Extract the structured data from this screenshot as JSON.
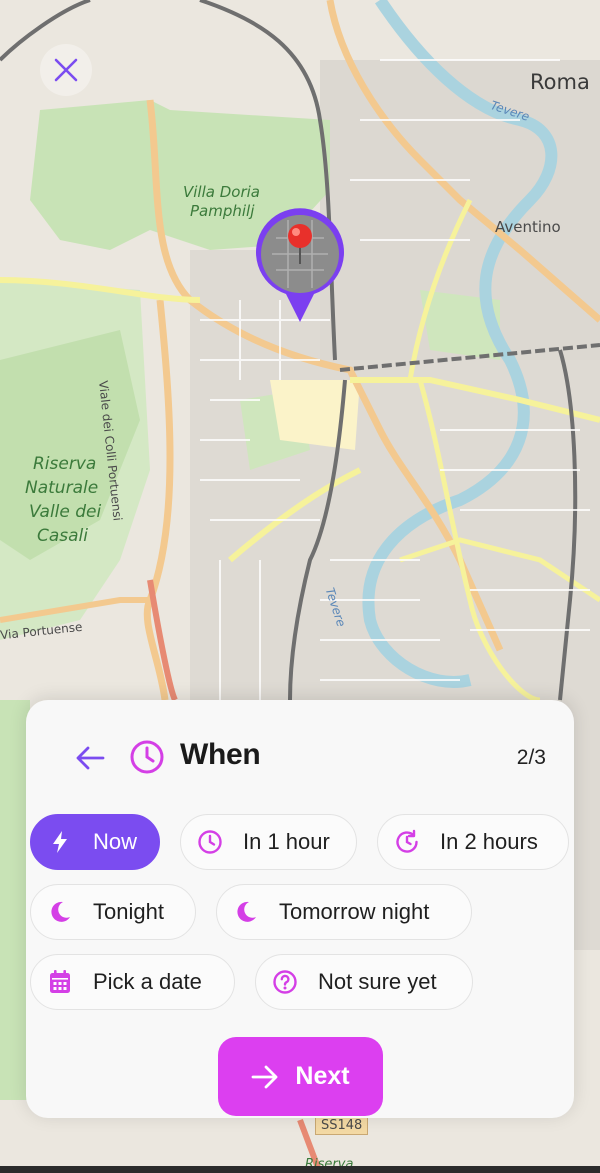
{
  "map": {
    "labels": {
      "roma": "Roma",
      "villa_doria": "Villa Doria",
      "pamphilj": "Pamphilj",
      "tevere_top": "Tevere",
      "aventino": "Aventino",
      "viale_colli": "Viale dei Colli Portuensi",
      "riserva1": "Riserva",
      "riserva2": "Naturale",
      "riserva3": "Valle dei",
      "riserva4": "Casali",
      "via_portuense": "Via Portuense",
      "tevere_mid": "Tevere",
      "ss148": "SS148",
      "riserva_bottom": "Riserva"
    },
    "colors": {
      "park": "#c8e3b6",
      "road_major": "#f3c98f",
      "road_yellow": "#f6f29b",
      "water": "#aad3df",
      "rail": "#6f6f6f"
    }
  },
  "close_icon": "close-icon",
  "marker": {
    "icon": "location-pin-icon",
    "accent": "#7b3ff0"
  },
  "sheet": {
    "back_icon": "arrow-left-icon",
    "title_icon": "clock-icon",
    "title": "When",
    "step": "2/3",
    "options": [
      {
        "label": "Now",
        "icon": "lightning-icon",
        "selected": true
      },
      {
        "label": "In 1 hour",
        "icon": "clock-icon",
        "selected": false
      },
      {
        "label": "In 2 hours",
        "icon": "clock-refresh-icon",
        "selected": false
      },
      {
        "label": "Tonight",
        "icon": "moon-icon",
        "selected": false
      },
      {
        "label": "Tomorrow night",
        "icon": "moon-icon",
        "selected": false
      },
      {
        "label": "Pick a date",
        "icon": "calendar-icon",
        "selected": false
      },
      {
        "label": "Not sure yet",
        "icon": "question-circle-icon",
        "selected": false
      }
    ],
    "next": {
      "label": "Next",
      "icon": "arrow-right-icon"
    },
    "accent_purple": "#7b4cf0",
    "accent_magenta": "#dc3ff0"
  }
}
